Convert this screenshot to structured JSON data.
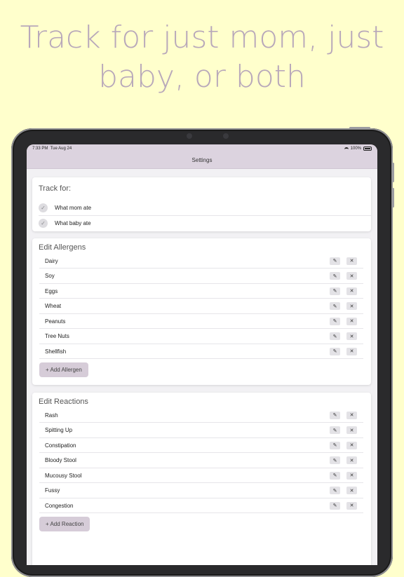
{
  "headline": {
    "line1": "Track for just mom, just",
    "line2": "baby, or both"
  },
  "statusbar": {
    "time": "7:33 PM",
    "date": "Tue Aug 24",
    "battery": "100%"
  },
  "nav": {
    "title": "Settings"
  },
  "track": {
    "title": "Track for:",
    "options": [
      {
        "label": "What mom ate",
        "checked": true
      },
      {
        "label": "What baby ate",
        "checked": true
      }
    ]
  },
  "allergens": {
    "title": "Edit Allergens",
    "items": [
      "Dairy",
      "Soy",
      "Eggs",
      "Wheat",
      "Peanuts",
      "Tree Nuts",
      "Shellfish"
    ],
    "add_label": "+ Add Allergen"
  },
  "reactions": {
    "title": "Edit Reactions",
    "items": [
      "Rash",
      "Spitting Up",
      "Constipation",
      "Bloody Stool",
      "Mucousy Stool",
      "Fussy",
      "Congestion"
    ],
    "add_label": "+ Add Reaction"
  },
  "icons": {
    "edit": "pencil-icon",
    "delete": "close-icon",
    "check": "checkmark-icon"
  },
  "colors": {
    "background": "#FFFFCC",
    "headline": "#B8A8BA",
    "nav": "#DCD3DF",
    "add_button": "#D6CCD8"
  }
}
